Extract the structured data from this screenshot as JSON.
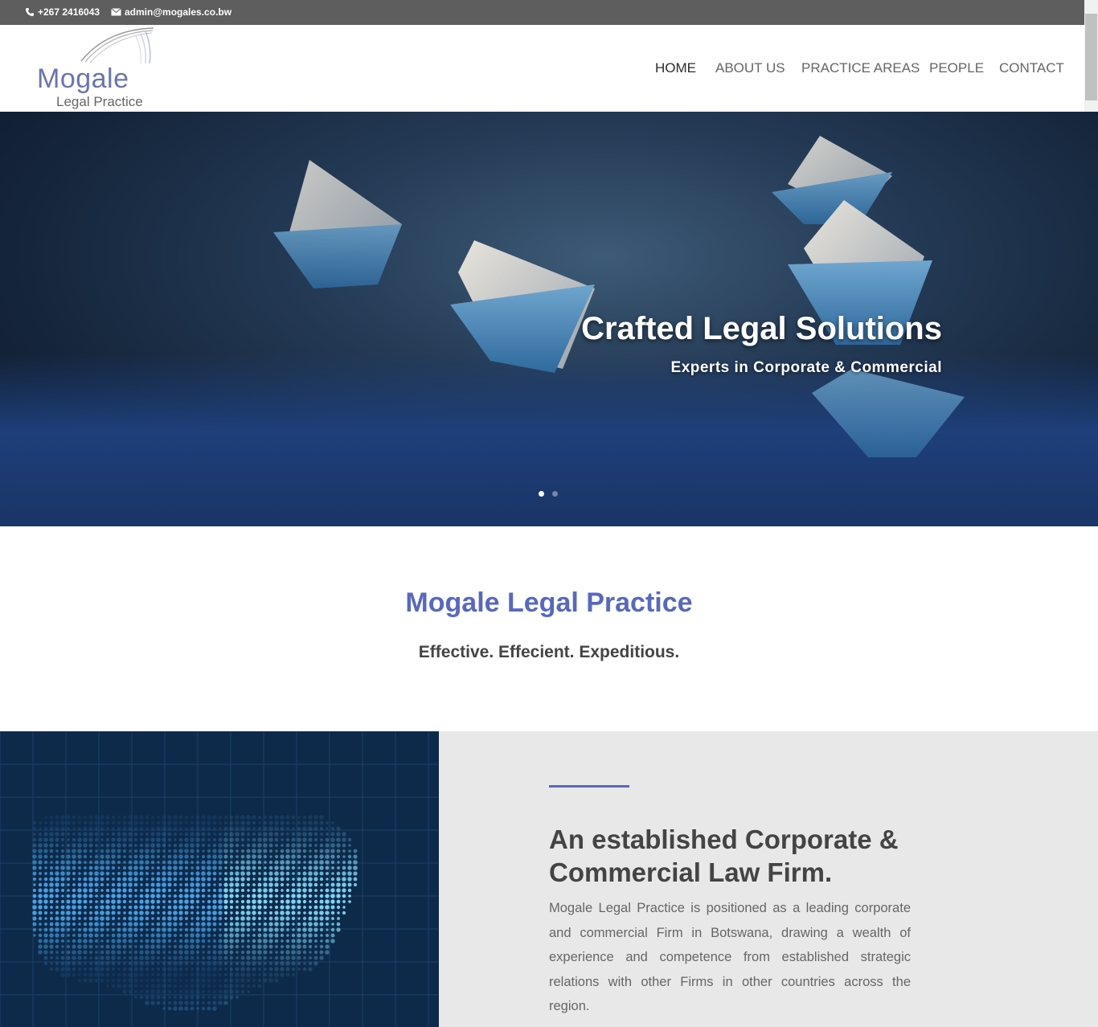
{
  "topbar": {
    "phone": "+267 2416043",
    "email": "admin@mogales.co.bw"
  },
  "logo": {
    "name": "Mogale",
    "subtitle": "Legal Practice"
  },
  "nav": {
    "items": [
      {
        "label": "HOME",
        "active": true
      },
      {
        "label": "ABOUT US",
        "active": false
      },
      {
        "label": "PRACTICE AREAS",
        "active": false
      },
      {
        "label": "PEOPLE",
        "active": false
      },
      {
        "label": "CONTACT",
        "active": false
      }
    ]
  },
  "hero": {
    "title": "Crafted Legal Solutions",
    "subtitle": "Experts in Corporate & Commercial",
    "slide_count": 2,
    "active_slide": 1
  },
  "intro": {
    "heading": "Mogale Legal Practice",
    "tagline": "Effective. Effecient. Expeditious."
  },
  "about": {
    "heading": "An established Corporate & Commercial Law Firm.",
    "body": "Mogale Legal Practice is positioned as a leading corporate and commercial Firm in Botswana, drawing  a wealth of experience and competence from established strategic relations with other Firms in other countries across the region."
  },
  "colors": {
    "accent": "#5868c1",
    "topbar": "#5e5e5e",
    "about_bg": "#e8e8e8"
  }
}
